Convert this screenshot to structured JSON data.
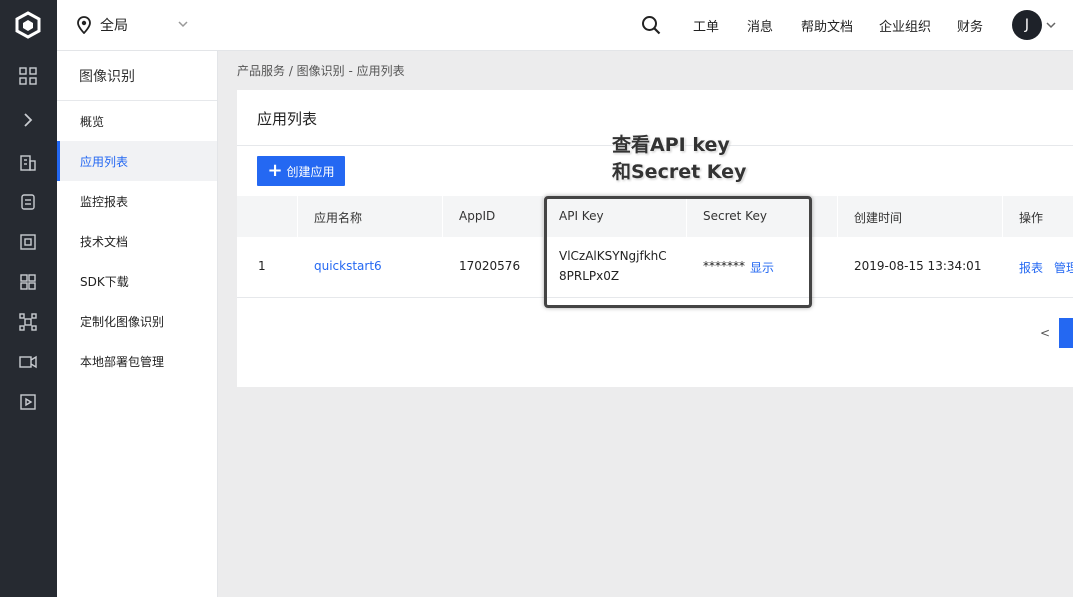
{
  "topbar": {
    "region_label": "全局",
    "nav": [
      "工单",
      "消息",
      "帮助文档",
      "企业组织",
      "财务"
    ],
    "avatar_initial": "J"
  },
  "rail_icons": [
    "logo-icon",
    "grid-icon",
    "expand-icon",
    "building-icon",
    "database-icon",
    "server-icon",
    "apps-icon",
    "network-icon",
    "video-icon",
    "play-icon"
  ],
  "sidebar": {
    "title": "图像识别",
    "items": [
      {
        "label": "概览",
        "active": false
      },
      {
        "label": "应用列表",
        "active": true
      },
      {
        "label": "监控报表",
        "active": false
      },
      {
        "label": "技术文档",
        "active": false
      },
      {
        "label": "SDK下载",
        "active": false
      },
      {
        "label": "定制化图像识别",
        "active": false
      },
      {
        "label": "本地部署包管理",
        "active": false
      }
    ]
  },
  "breadcrumb": "产品服务  /  图像识别 - 应用列表",
  "main": {
    "title": "应用列表",
    "create_button": "创建应用",
    "columns": [
      "应用名称",
      "AppID",
      "API Key",
      "Secret Key",
      "创建时间",
      "操作"
    ],
    "rows": [
      {
        "index": "1",
        "name": "quickstart6",
        "appid": "17020576",
        "api_key_line1": "VlCzAlKSYNgjfkhC",
        "api_key_line2": "8PRLPx0Z",
        "secret_masked": "*******",
        "secret_show": "显示",
        "created": "2019-08-15 13:34:01",
        "actions": [
          "报表",
          "管理"
        ]
      }
    ],
    "pager_prev": "<"
  },
  "annotation": {
    "line1": "查看API key",
    "line2": "和Secret Key"
  },
  "colors": {
    "accent": "#2468f2",
    "rail": "#262a31"
  }
}
